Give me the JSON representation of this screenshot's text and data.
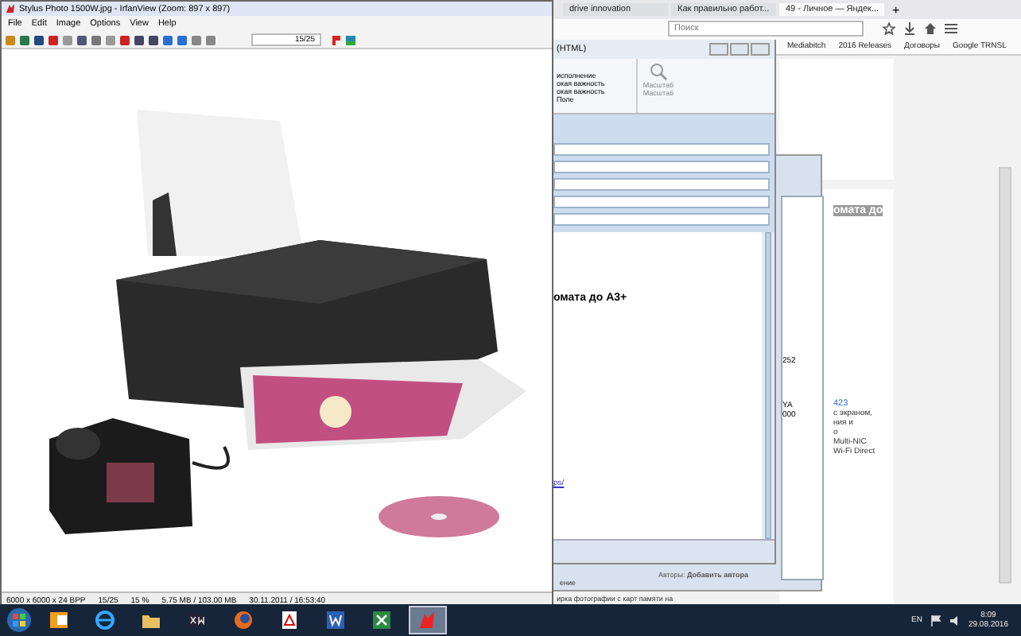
{
  "browser": {
    "tabs": [
      {
        "label": "drive innovation",
        "selected": false
      },
      {
        "label": "Как правильно работ...",
        "selected": false
      },
      {
        "label": "49 - Личное — Яндек...",
        "selected": true
      }
    ],
    "new_tab": "+",
    "search": {
      "placeholder": "Поиск"
    },
    "bookmarks": [
      "Mediabitch",
      "2016 Releases",
      "Договоры",
      "Google TRNSL"
    ],
    "highlight_text": "омата до",
    "product_number": "423",
    "specs": [
      "с экраном,",
      "ния и",
      "о",
      "Multi-NIC",
      "Wi-Fi Direct"
    ],
    "page_text": "ирка фотографии с карт памяти на"
  },
  "mail_window": {
    "title": "(HTML)",
    "ribbon_items": [
      "исполнение",
      "окая важность",
      "окая важность",
      "Поле"
    ],
    "zoom_labels": [
      "Масштаб",
      "Масштаб"
    ],
    "heading": "омата до A3+",
    "link": "ps/"
  },
  "side_window": {
    "texts": [
      "252",
      "YA",
      "000"
    ],
    "authors_label": "Авторы:",
    "authors_value": "Добавить автора",
    "footer_text": "ение"
  },
  "irfanview": {
    "title": "Stylus Photo 1500W.jpg - IrfanView (Zoom: 897 x 897)",
    "menu": [
      "File",
      "Edit",
      "Image",
      "Options",
      "View",
      "Help"
    ],
    "page_field": "15/25",
    "status": [
      "6000 x 6000 x 24 BPP",
      "15/25",
      "15 %",
      "5.75 MB / 103.00 MB",
      "30.11.2011 / 16:53:40"
    ]
  },
  "taskbar": {
    "apps": [
      {
        "kind": "outlook",
        "selected": false
      },
      {
        "kind": "ie",
        "selected": false
      },
      {
        "kind": "folder",
        "selected": false
      },
      {
        "kind": "xm",
        "selected": false
      },
      {
        "kind": "firefox",
        "selected": false
      },
      {
        "kind": "pdf",
        "selected": false
      },
      {
        "kind": "word",
        "selected": false
      },
      {
        "kind": "excel",
        "selected": false
      },
      {
        "kind": "irfanview",
        "selected": true
      }
    ],
    "language": "EN",
    "time": "8:09",
    "date": "29.08.2016"
  }
}
